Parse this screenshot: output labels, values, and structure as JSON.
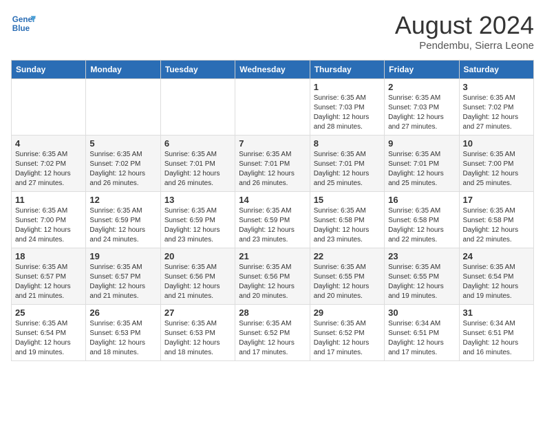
{
  "header": {
    "logo_line1": "General",
    "logo_line2": "Blue",
    "month_title": "August 2024",
    "subtitle": "Pendembu, Sierra Leone"
  },
  "days_of_week": [
    "Sunday",
    "Monday",
    "Tuesday",
    "Wednesday",
    "Thursday",
    "Friday",
    "Saturday"
  ],
  "weeks": [
    [
      {
        "day": "",
        "info": ""
      },
      {
        "day": "",
        "info": ""
      },
      {
        "day": "",
        "info": ""
      },
      {
        "day": "",
        "info": ""
      },
      {
        "day": "1",
        "info": "Sunrise: 6:35 AM\nSunset: 7:03 PM\nDaylight: 12 hours\nand 28 minutes."
      },
      {
        "day": "2",
        "info": "Sunrise: 6:35 AM\nSunset: 7:03 PM\nDaylight: 12 hours\nand 27 minutes."
      },
      {
        "day": "3",
        "info": "Sunrise: 6:35 AM\nSunset: 7:02 PM\nDaylight: 12 hours\nand 27 minutes."
      }
    ],
    [
      {
        "day": "4",
        "info": "Sunrise: 6:35 AM\nSunset: 7:02 PM\nDaylight: 12 hours\nand 27 minutes."
      },
      {
        "day": "5",
        "info": "Sunrise: 6:35 AM\nSunset: 7:02 PM\nDaylight: 12 hours\nand 26 minutes."
      },
      {
        "day": "6",
        "info": "Sunrise: 6:35 AM\nSunset: 7:01 PM\nDaylight: 12 hours\nand 26 minutes."
      },
      {
        "day": "7",
        "info": "Sunrise: 6:35 AM\nSunset: 7:01 PM\nDaylight: 12 hours\nand 26 minutes."
      },
      {
        "day": "8",
        "info": "Sunrise: 6:35 AM\nSunset: 7:01 PM\nDaylight: 12 hours\nand 25 minutes."
      },
      {
        "day": "9",
        "info": "Sunrise: 6:35 AM\nSunset: 7:01 PM\nDaylight: 12 hours\nand 25 minutes."
      },
      {
        "day": "10",
        "info": "Sunrise: 6:35 AM\nSunset: 7:00 PM\nDaylight: 12 hours\nand 25 minutes."
      }
    ],
    [
      {
        "day": "11",
        "info": "Sunrise: 6:35 AM\nSunset: 7:00 PM\nDaylight: 12 hours\nand 24 minutes."
      },
      {
        "day": "12",
        "info": "Sunrise: 6:35 AM\nSunset: 6:59 PM\nDaylight: 12 hours\nand 24 minutes."
      },
      {
        "day": "13",
        "info": "Sunrise: 6:35 AM\nSunset: 6:59 PM\nDaylight: 12 hours\nand 23 minutes."
      },
      {
        "day": "14",
        "info": "Sunrise: 6:35 AM\nSunset: 6:59 PM\nDaylight: 12 hours\nand 23 minutes."
      },
      {
        "day": "15",
        "info": "Sunrise: 6:35 AM\nSunset: 6:58 PM\nDaylight: 12 hours\nand 23 minutes."
      },
      {
        "day": "16",
        "info": "Sunrise: 6:35 AM\nSunset: 6:58 PM\nDaylight: 12 hours\nand 22 minutes."
      },
      {
        "day": "17",
        "info": "Sunrise: 6:35 AM\nSunset: 6:58 PM\nDaylight: 12 hours\nand 22 minutes."
      }
    ],
    [
      {
        "day": "18",
        "info": "Sunrise: 6:35 AM\nSunset: 6:57 PM\nDaylight: 12 hours\nand 21 minutes."
      },
      {
        "day": "19",
        "info": "Sunrise: 6:35 AM\nSunset: 6:57 PM\nDaylight: 12 hours\nand 21 minutes."
      },
      {
        "day": "20",
        "info": "Sunrise: 6:35 AM\nSunset: 6:56 PM\nDaylight: 12 hours\nand 21 minutes."
      },
      {
        "day": "21",
        "info": "Sunrise: 6:35 AM\nSunset: 6:56 PM\nDaylight: 12 hours\nand 20 minutes."
      },
      {
        "day": "22",
        "info": "Sunrise: 6:35 AM\nSunset: 6:55 PM\nDaylight: 12 hours\nand 20 minutes."
      },
      {
        "day": "23",
        "info": "Sunrise: 6:35 AM\nSunset: 6:55 PM\nDaylight: 12 hours\nand 19 minutes."
      },
      {
        "day": "24",
        "info": "Sunrise: 6:35 AM\nSunset: 6:54 PM\nDaylight: 12 hours\nand 19 minutes."
      }
    ],
    [
      {
        "day": "25",
        "info": "Sunrise: 6:35 AM\nSunset: 6:54 PM\nDaylight: 12 hours\nand 19 minutes."
      },
      {
        "day": "26",
        "info": "Sunrise: 6:35 AM\nSunset: 6:53 PM\nDaylight: 12 hours\nand 18 minutes."
      },
      {
        "day": "27",
        "info": "Sunrise: 6:35 AM\nSunset: 6:53 PM\nDaylight: 12 hours\nand 18 minutes."
      },
      {
        "day": "28",
        "info": "Sunrise: 6:35 AM\nSunset: 6:52 PM\nDaylight: 12 hours\nand 17 minutes."
      },
      {
        "day": "29",
        "info": "Sunrise: 6:35 AM\nSunset: 6:52 PM\nDaylight: 12 hours\nand 17 minutes."
      },
      {
        "day": "30",
        "info": "Sunrise: 6:34 AM\nSunset: 6:51 PM\nDaylight: 12 hours\nand 17 minutes."
      },
      {
        "day": "31",
        "info": "Sunrise: 6:34 AM\nSunset: 6:51 PM\nDaylight: 12 hours\nand 16 minutes."
      }
    ]
  ]
}
